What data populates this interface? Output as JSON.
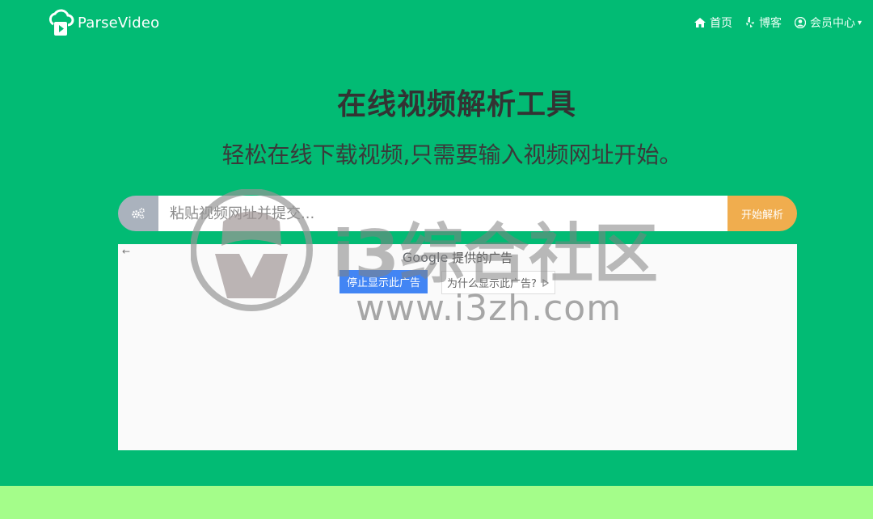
{
  "brand": {
    "name": "ParseVideo",
    "icon": "cloud-play-logo-icon"
  },
  "nav": {
    "items": [
      {
        "label": "首页",
        "icon": "home-icon"
      },
      {
        "label": "博客",
        "icon": "yelp-icon"
      },
      {
        "label": "会员中心",
        "icon": "user-circle-icon",
        "caret": "▾"
      }
    ]
  },
  "hero": {
    "title": "在线视频解析工具",
    "subtitle": "轻松在线下载视频,只需要输入视频网址开始。"
  },
  "search": {
    "placeholder": "粘贴视频网址并提交...",
    "button": "开始解析",
    "icon": "gears-icon"
  },
  "ad": {
    "back": "←",
    "provider_brand": "Google",
    "provider_suffix": " 提供的广告",
    "stop_button": "停止显示此广告",
    "why_button": "为什么显示此广告?"
  },
  "watermark": {
    "text": "i3综合社区",
    "domain": "www.i3zh.com"
  },
  "colors": {
    "page_bg": "#02bb74",
    "title_text": "#333333",
    "button_orange": "#f0ad4e",
    "gear_gray": "#aab2bd",
    "ad_stop_blue": "#4285f4",
    "footer_green": "#a4fd8a"
  }
}
